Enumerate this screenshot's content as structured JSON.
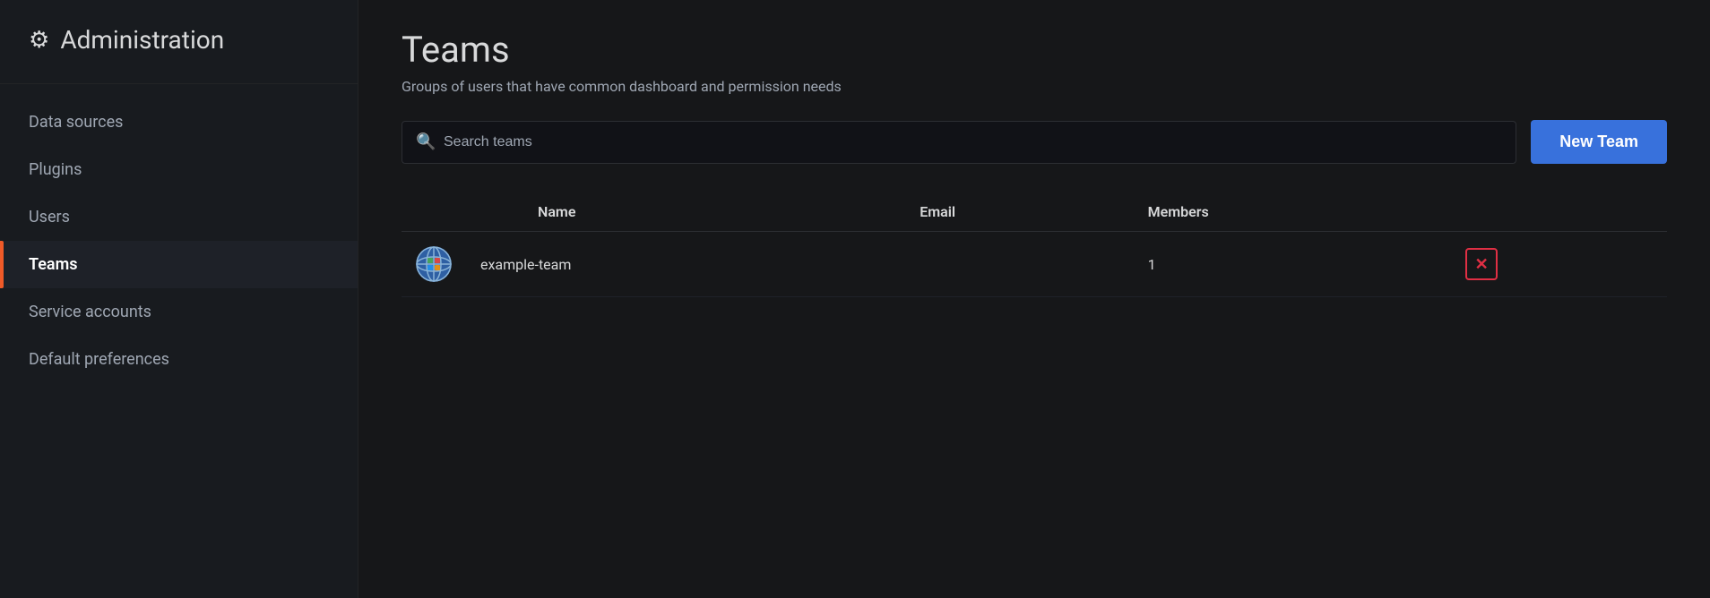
{
  "sidebar": {
    "header": {
      "title": "Administration",
      "icon": "⚙"
    },
    "items": [
      {
        "label": "Data sources",
        "id": "data-sources",
        "active": false
      },
      {
        "label": "Plugins",
        "id": "plugins",
        "active": false
      },
      {
        "label": "Users",
        "id": "users",
        "active": false
      },
      {
        "label": "Teams",
        "id": "teams",
        "active": true
      },
      {
        "label": "Service accounts",
        "id": "service-accounts",
        "active": false
      },
      {
        "label": "Default preferences",
        "id": "default-preferences",
        "active": false
      }
    ]
  },
  "main": {
    "page_title": "Teams",
    "page_subtitle": "Groups of users that have common dashboard and permission needs",
    "search_placeholder": "Search teams",
    "new_team_button_label": "New Team",
    "table": {
      "columns": [
        {
          "label": "Name",
          "id": "name"
        },
        {
          "label": "Email",
          "id": "email"
        },
        {
          "label": "Members",
          "id": "members"
        }
      ],
      "rows": [
        {
          "id": "example-team",
          "name": "example-team",
          "email": "",
          "members": "1"
        }
      ]
    }
  },
  "colors": {
    "accent_orange": "#f05a28",
    "accent_blue": "#3871dc",
    "delete_red": "#e02f44",
    "bg_dark": "#161719",
    "bg_sidebar": "#181b1f",
    "text_primary": "#d8d9da",
    "text_secondary": "#9fa7b3"
  }
}
